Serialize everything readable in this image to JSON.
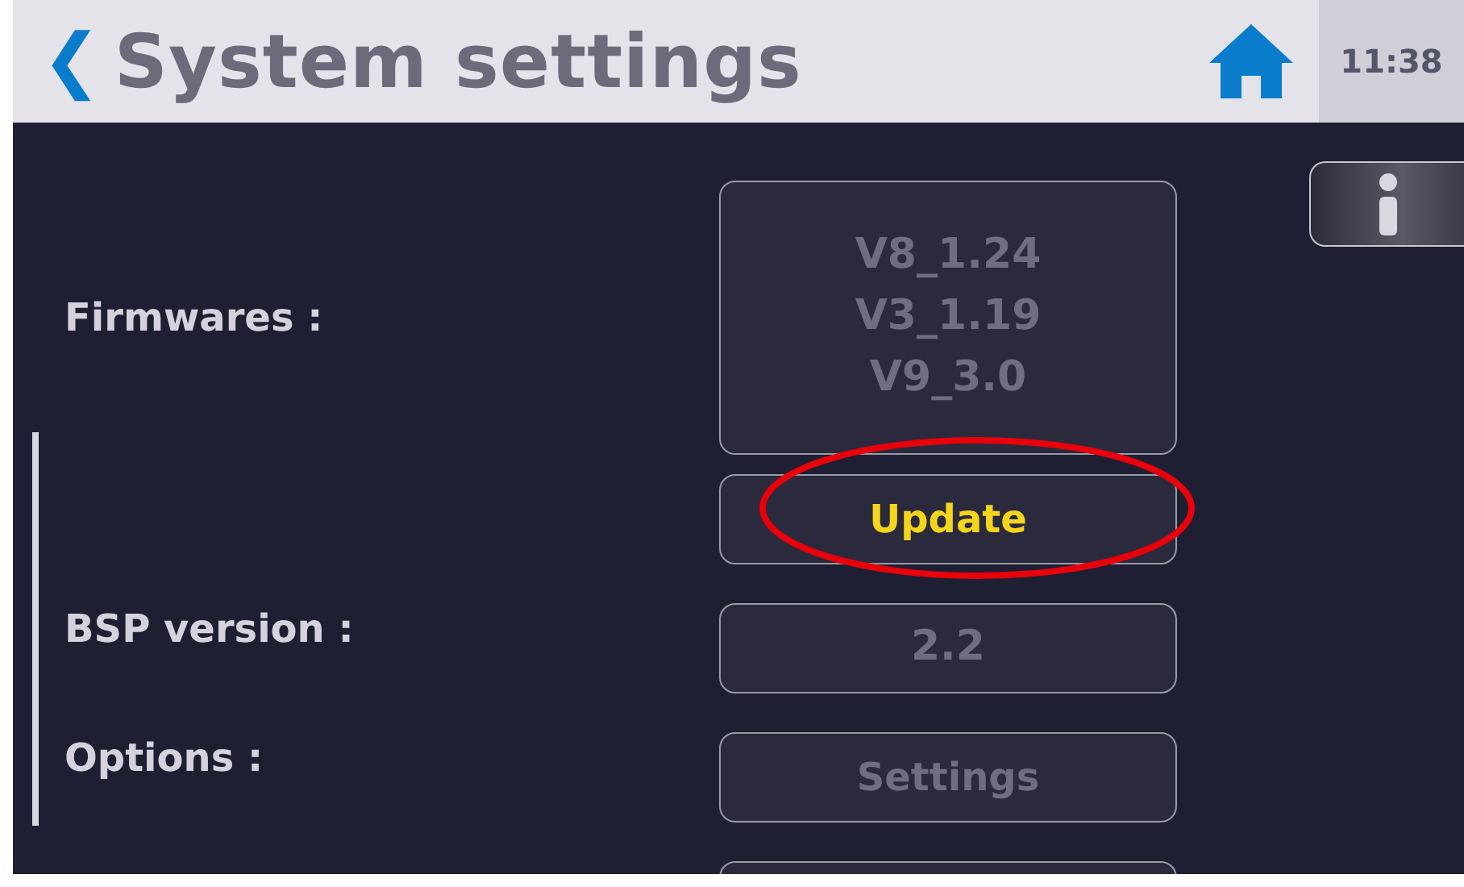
{
  "header": {
    "back": "❮",
    "title": "System settings",
    "time": "11:38"
  },
  "rows": [
    {
      "kind": "readout",
      "label": "Firmwares :",
      "lines": [
        "V8_1.24",
        "V3_1.19",
        "V9_3.0"
      ]
    },
    {
      "kind": "button",
      "text": "Update",
      "disabled": false
    },
    {
      "kind": "readout",
      "label": "BSP version :",
      "lines": [
        "2.2"
      ]
    },
    {
      "kind": "button",
      "label": "Options :",
      "text": "Settings",
      "disabled": true
    },
    {
      "kind": "button"
    }
  ]
}
